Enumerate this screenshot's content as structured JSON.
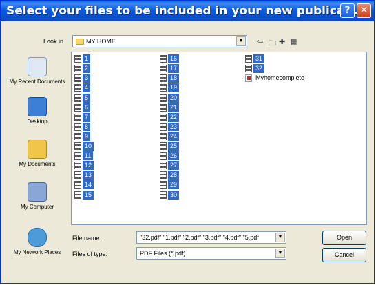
{
  "dialog": {
    "title": "Select your files to be included in your new publica...",
    "help_glyph": "?",
    "close_glyph": "✕"
  },
  "toolbar": {
    "look_in_label": "Look in",
    "look_in_value": "MY HOME"
  },
  "places": [
    {
      "label": "My Recent Documents",
      "icon": "recent-documents-icon"
    },
    {
      "label": "Desktop",
      "icon": "desktop-icon"
    },
    {
      "label": "My Documents",
      "icon": "my-documents-icon"
    },
    {
      "label": "My Computer",
      "icon": "my-computer-icon"
    },
    {
      "label": "My Network Places",
      "icon": "network-places-icon"
    }
  ],
  "files": {
    "column1": [
      "1",
      "2",
      "3",
      "4",
      "5",
      "6",
      "7",
      "8",
      "9",
      "10",
      "11",
      "12",
      "13",
      "14",
      "15"
    ],
    "column2": [
      "16",
      "17",
      "18",
      "19",
      "20",
      "21",
      "22",
      "23",
      "24",
      "25",
      "26",
      "27",
      "28",
      "29",
      "30"
    ],
    "column3": [
      "31",
      "32"
    ],
    "unselected": "Myhomecomplete"
  },
  "footer": {
    "file_name_label": "File name:",
    "file_name_value": "\"32.pdf\" \"1.pdf\" \"2.pdf\" \"3.pdf\" \"4.pdf\" \"5.pdf",
    "file_type_label": "Files of type:",
    "file_type_value": "PDF Files (*.pdf)",
    "open_label": "Open",
    "cancel_label": "Cancel"
  },
  "colors": {
    "title_bar": "#0a5fe8",
    "selection": "#316ac5",
    "dialog_bg": "#ece9d8"
  }
}
